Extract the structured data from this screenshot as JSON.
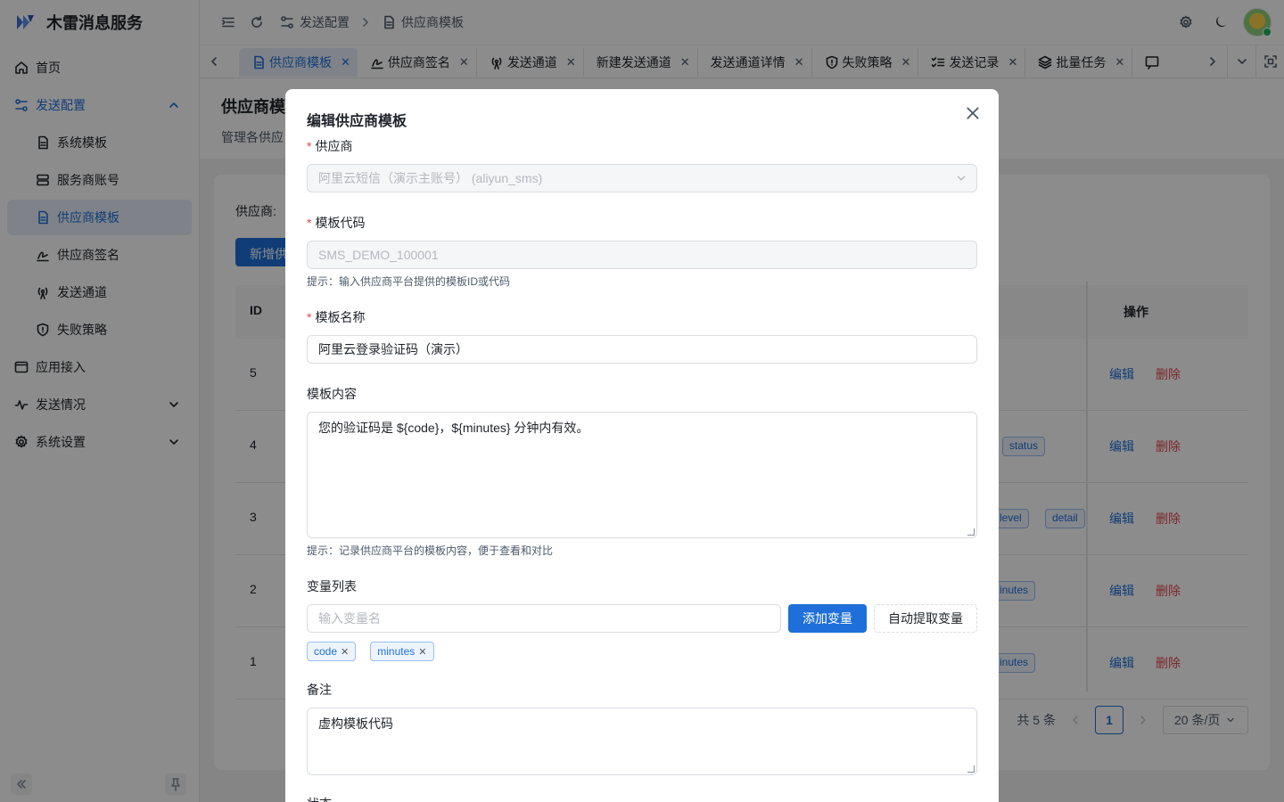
{
  "app": {
    "name": "木雷消息服务"
  },
  "sidebar": {
    "items": [
      {
        "label": "首页",
        "icon": "home-icon"
      },
      {
        "label": "发送配置",
        "icon": "config-icon"
      },
      {
        "label": "系统模板",
        "icon": "doc-icon"
      },
      {
        "label": "服务商账号",
        "icon": "server-icon"
      },
      {
        "label": "供应商模板",
        "icon": "doc-icon"
      },
      {
        "label": "供应商签名",
        "icon": "signature-icon"
      },
      {
        "label": "发送通道",
        "icon": "antenna-icon"
      },
      {
        "label": "失败策略",
        "icon": "shield-icon"
      },
      {
        "label": "应用接入",
        "icon": "app-icon"
      },
      {
        "label": "发送情况",
        "icon": "chart-icon"
      },
      {
        "label": "系统设置",
        "icon": "gear-icon"
      }
    ]
  },
  "header": {
    "breadcrumb": [
      "发送配置",
      "供应商模板"
    ]
  },
  "tabs": [
    {
      "label": "供应商模板"
    },
    {
      "label": "供应商签名"
    },
    {
      "label": "发送通道"
    },
    {
      "label": "新建发送通道"
    },
    {
      "label": "发送通道详情"
    },
    {
      "label": "失败策略"
    },
    {
      "label": "发送记录"
    },
    {
      "label": "批量任务"
    }
  ],
  "page": {
    "title": "供应商模",
    "description": "管理各供应",
    "filter_label": "供应商:",
    "add_button": "新增供",
    "table": {
      "col_id": "ID",
      "col_ops": "操作",
      "rows": [
        {
          "id": "5",
          "tags": []
        },
        {
          "id": "4",
          "tags": [
            "status"
          ]
        },
        {
          "id": "3",
          "tags": [
            "level",
            "detail"
          ]
        },
        {
          "id": "2",
          "tags": [
            "inutes"
          ]
        },
        {
          "id": "1",
          "tags": [
            "inutes"
          ]
        }
      ],
      "edit_label": "编辑",
      "delete_label": "删除"
    },
    "pagination": {
      "total": "共 5 条",
      "current_page": "1",
      "page_size": "20 条/页"
    }
  },
  "modal": {
    "title": "编辑供应商模板",
    "provider": {
      "label": "供应商",
      "value": "阿里云短信（演示主账号） (aliyun_sms)"
    },
    "template_code": {
      "label": "模板代码",
      "value": "SMS_DEMO_100001",
      "hint": "提示：输入供应商平台提供的模板ID或代码"
    },
    "template_name": {
      "label": "模板名称",
      "value": "阿里云登录验证码（演示）"
    },
    "template_content": {
      "label": "模板内容",
      "value": "您的验证码是 ${code}，${minutes} 分钟内有效。",
      "hint": "提示：记录供应商平台的模板内容，便于查看和对比"
    },
    "variables": {
      "label": "变量列表",
      "placeholder": "输入变量名",
      "add_button": "添加变量",
      "auto_button": "自动提取变量",
      "chips": [
        "code",
        "minutes"
      ]
    },
    "remark": {
      "label": "备注",
      "value": "虚构模板代码"
    },
    "status": {
      "label": "状态"
    }
  },
  "colors": {
    "primary": "#1e6fd9",
    "danger": "#e5484d",
    "overlay": "rgba(0,0,0,0.45)"
  }
}
